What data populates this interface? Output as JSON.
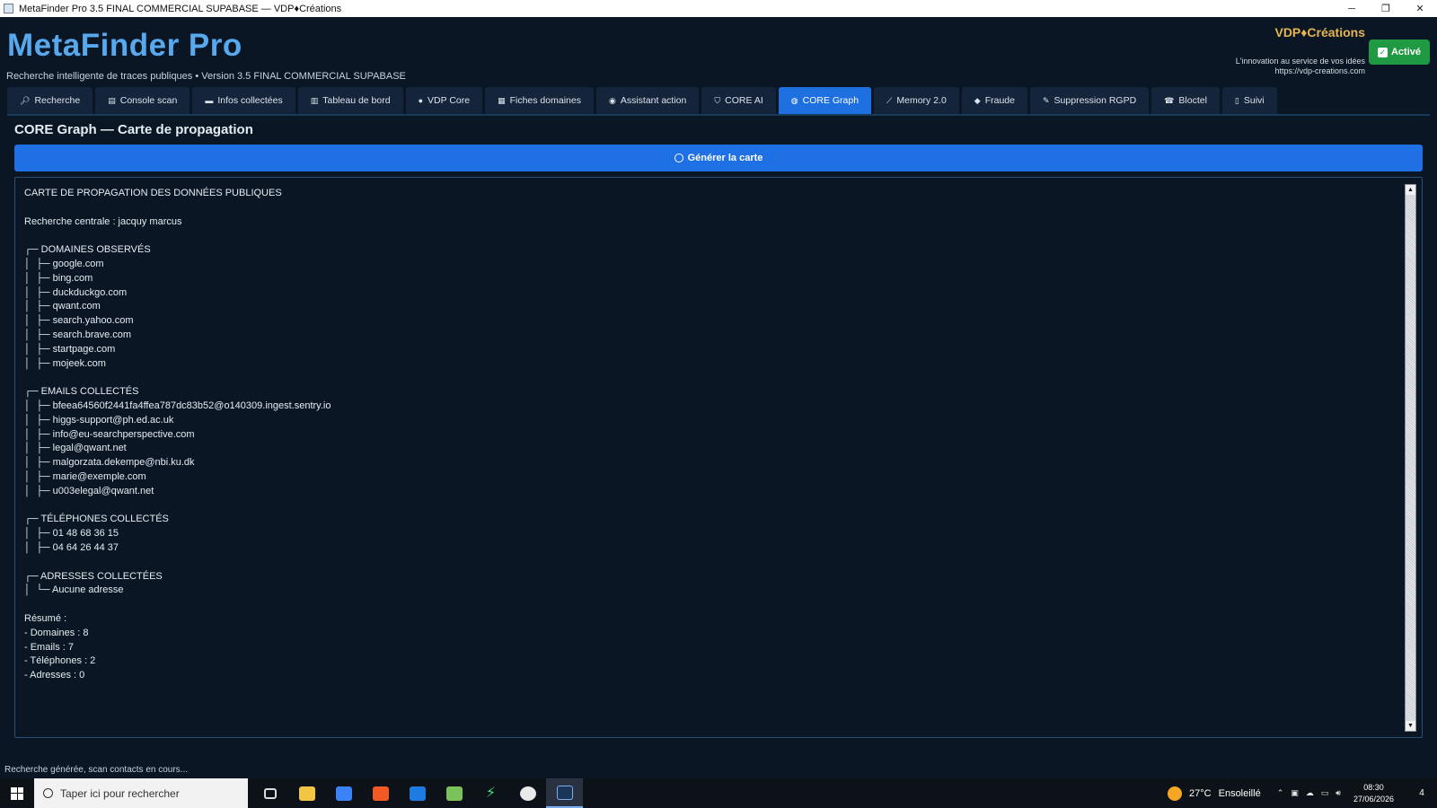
{
  "window": {
    "title": "MetaFinder Pro 3.5 FINAL COMMERCIAL SUPABASE — VDP♦Créations"
  },
  "header": {
    "brand": "MetaFinder Pro",
    "subtitle": "Recherche intelligente de traces publiques • Version 3.5 FINAL COMMERCIAL SUPABASE",
    "company": "VDP♦Créations",
    "tagline": "L'innovation au service de vos idées",
    "website": "https://vdp-creations.com",
    "active_label": "Activé"
  },
  "tabs": [
    {
      "label": "Recherche",
      "icon": "search-icon"
    },
    {
      "label": "Console scan",
      "icon": "console-icon"
    },
    {
      "label": "Infos collectées",
      "icon": "folder-icon"
    },
    {
      "label": "Tableau de bord",
      "icon": "dashboard-icon"
    },
    {
      "label": "VDP Core",
      "icon": "core-icon"
    },
    {
      "label": "Fiches domaines",
      "icon": "domain-icon"
    },
    {
      "label": "Assistant action",
      "icon": "assistant-icon"
    },
    {
      "label": "CORE AI",
      "icon": "shield-icon"
    },
    {
      "label": "CORE Graph",
      "icon": "globe-icon",
      "active": true
    },
    {
      "label": "Memory 2.0",
      "icon": "memory-icon"
    },
    {
      "label": "Fraude",
      "icon": "fraud-icon"
    },
    {
      "label": "Suppression RGPD",
      "icon": "delete-icon"
    },
    {
      "label": "Bloctel",
      "icon": "phone-block-icon"
    },
    {
      "label": "Suivi",
      "icon": "clipboard-icon"
    }
  ],
  "panel": {
    "title": "CORE Graph — Carte de propagation",
    "generate_label": "Générer la carte"
  },
  "output": {
    "lines": [
      "CARTE DE PROPAGATION DES DONNÉES PUBLIQUES",
      "",
      "Recherche centrale : jacquy marcus",
      "",
      "┌─ DOMAINES OBSERVÉS",
      "│  ├─ google.com",
      "│  ├─ bing.com",
      "│  ├─ duckduckgo.com",
      "│  ├─ qwant.com",
      "│  ├─ search.yahoo.com",
      "│  ├─ search.brave.com",
      "│  ├─ startpage.com",
      "│  ├─ mojeek.com",
      "",
      "┌─ EMAILS COLLECTÉS",
      "│  ├─ bfeea64560f2441fa4ffea787dc83b52@o140309.ingest.sentry.io",
      "│  ├─ higgs-support@ph.ed.ac.uk",
      "│  ├─ info@eu-searchperspective.com",
      "│  ├─ legal@qwant.net",
      "│  ├─ malgorzata.dekempe@nbi.ku.dk",
      "│  ├─ marie@exemple.com",
      "│  ├─ u003elegal@qwant.net",
      "",
      "┌─ TÉLÉPHONES COLLECTÉS",
      "│  ├─ 01 48 68 36 15",
      "│  ├─ 04 64 26 44 37",
      "",
      "┌─ ADRESSES COLLECTÉES",
      "│  └─ Aucune adresse",
      "",
      "Résumé :",
      "- Domaines : 8",
      "- Emails : 7",
      "- Téléphones : 2",
      "- Adresses : 0"
    ]
  },
  "status_bar": {
    "text": "Recherche générée, scan contacts en cours..."
  },
  "taskbar": {
    "search_placeholder": "Taper ici pour rechercher",
    "weather_temp": "27°C",
    "weather_label": "Ensoleillé",
    "time": "08:30",
    "date": "27/06/2026",
    "notifications": "4"
  }
}
